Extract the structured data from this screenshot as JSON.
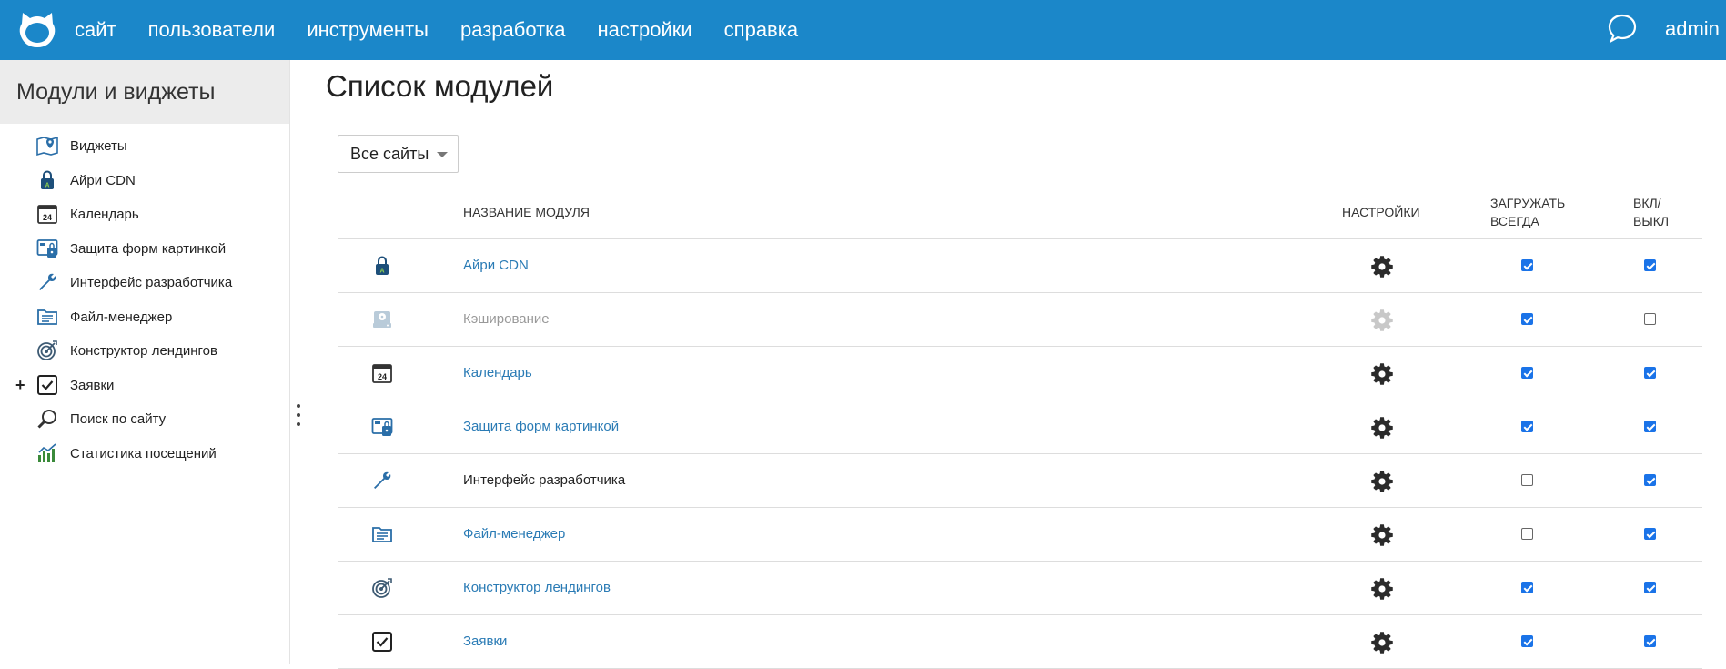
{
  "colors": {
    "topbar": "#1b87c9",
    "link": "#2a7bb5",
    "disabled": "#999999",
    "text": "#222222",
    "checkbox": "#1a73e8"
  },
  "topbar": {
    "nav": [
      "сайт",
      "пользователи",
      "инструменты",
      "разработка",
      "настройки",
      "справка"
    ],
    "user": "admin",
    "icons": [
      "logo-icon",
      "chat-icon"
    ]
  },
  "sidebar": {
    "title": "Модули и виджеты",
    "items": [
      {
        "label": "Виджеты",
        "icon": "widgets-map-icon"
      },
      {
        "label": "Айри CDN",
        "icon": "cdn-lock-icon"
      },
      {
        "label": "Календарь",
        "icon": "calendar-icon"
      },
      {
        "label": "Защита форм картинкой",
        "icon": "captcha-icon"
      },
      {
        "label": "Интерфейс разработчика",
        "icon": "wrench-icon"
      },
      {
        "label": "Файл-менеджер",
        "icon": "folder-icon"
      },
      {
        "label": "Конструктор лендингов",
        "icon": "target-icon"
      },
      {
        "label": "Заявки",
        "icon": "checkbox-icon",
        "expand": "+"
      },
      {
        "label": "Поиск по сайту",
        "icon": "search-icon"
      },
      {
        "label": "Статистика посещений",
        "icon": "stats-icon"
      }
    ]
  },
  "main": {
    "title": "Список модулей",
    "site_filter": "Все сайты",
    "table": {
      "headers": {
        "name": "НАЗВАНИЕ МОДУЛЯ",
        "settings": "НАСТРОЙКИ",
        "load_always_1": "ЗАГРУЖАТЬ",
        "load_always_2": "ВСЕГДА",
        "on_off_1": "ВКЛ/",
        "on_off_2": "ВЫКЛ"
      },
      "rows": [
        {
          "name": "Айри CDN",
          "icon": "cdn-lock-icon",
          "style": "link",
          "load_always": true,
          "enabled": true
        },
        {
          "name": "Кэширование",
          "icon": "cache-drive-icon",
          "style": "disabled",
          "load_always": true,
          "enabled": false
        },
        {
          "name": "Календарь",
          "icon": "calendar-icon",
          "style": "link",
          "load_always": true,
          "enabled": true
        },
        {
          "name": "Защита форм картинкой",
          "icon": "captcha-icon",
          "style": "link",
          "load_always": true,
          "enabled": true
        },
        {
          "name": "Интерфейс разработчика",
          "icon": "wrench-icon",
          "style": "plain",
          "load_always": false,
          "enabled": true
        },
        {
          "name": "Файл-менеджер",
          "icon": "folder-icon",
          "style": "link",
          "load_always": false,
          "enabled": true
        },
        {
          "name": "Конструктор лендингов",
          "icon": "target-icon",
          "style": "link",
          "load_always": true,
          "enabled": true
        },
        {
          "name": "Заявки",
          "icon": "checkbox-icon",
          "style": "link",
          "load_always": true,
          "enabled": true
        }
      ]
    }
  }
}
